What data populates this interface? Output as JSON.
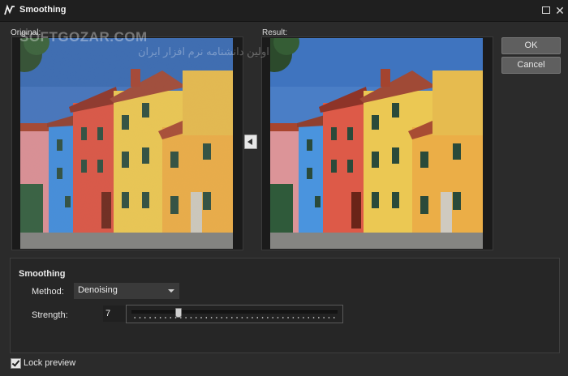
{
  "window": {
    "title": "Smoothing",
    "maximize_icon": "maximize-icon",
    "close_icon": "close-icon",
    "close_glyph": "✕"
  },
  "preview": {
    "original_label": "Original:",
    "result_label": "Result:",
    "copy_arrow_icon": "arrow-left-icon"
  },
  "buttons": {
    "ok": "OK",
    "cancel": "Cancel"
  },
  "settings": {
    "group_title": "Smoothing",
    "method_label": "Method:",
    "method_value": "Denoising",
    "strength_label": "Strength:",
    "strength_value": "7",
    "strength_fraction": 0.22
  },
  "footer": {
    "lock_preview_label": "Lock preview",
    "lock_preview_checked": true
  },
  "watermark": {
    "text": "SOFTGOZAR.COM",
    "subtext": "اولین دانشنامه نرم افزار ایران"
  },
  "colors": {
    "background": "#2b2b2b",
    "titlebar": "#1f1f1f",
    "button": "#5f5f5f"
  }
}
